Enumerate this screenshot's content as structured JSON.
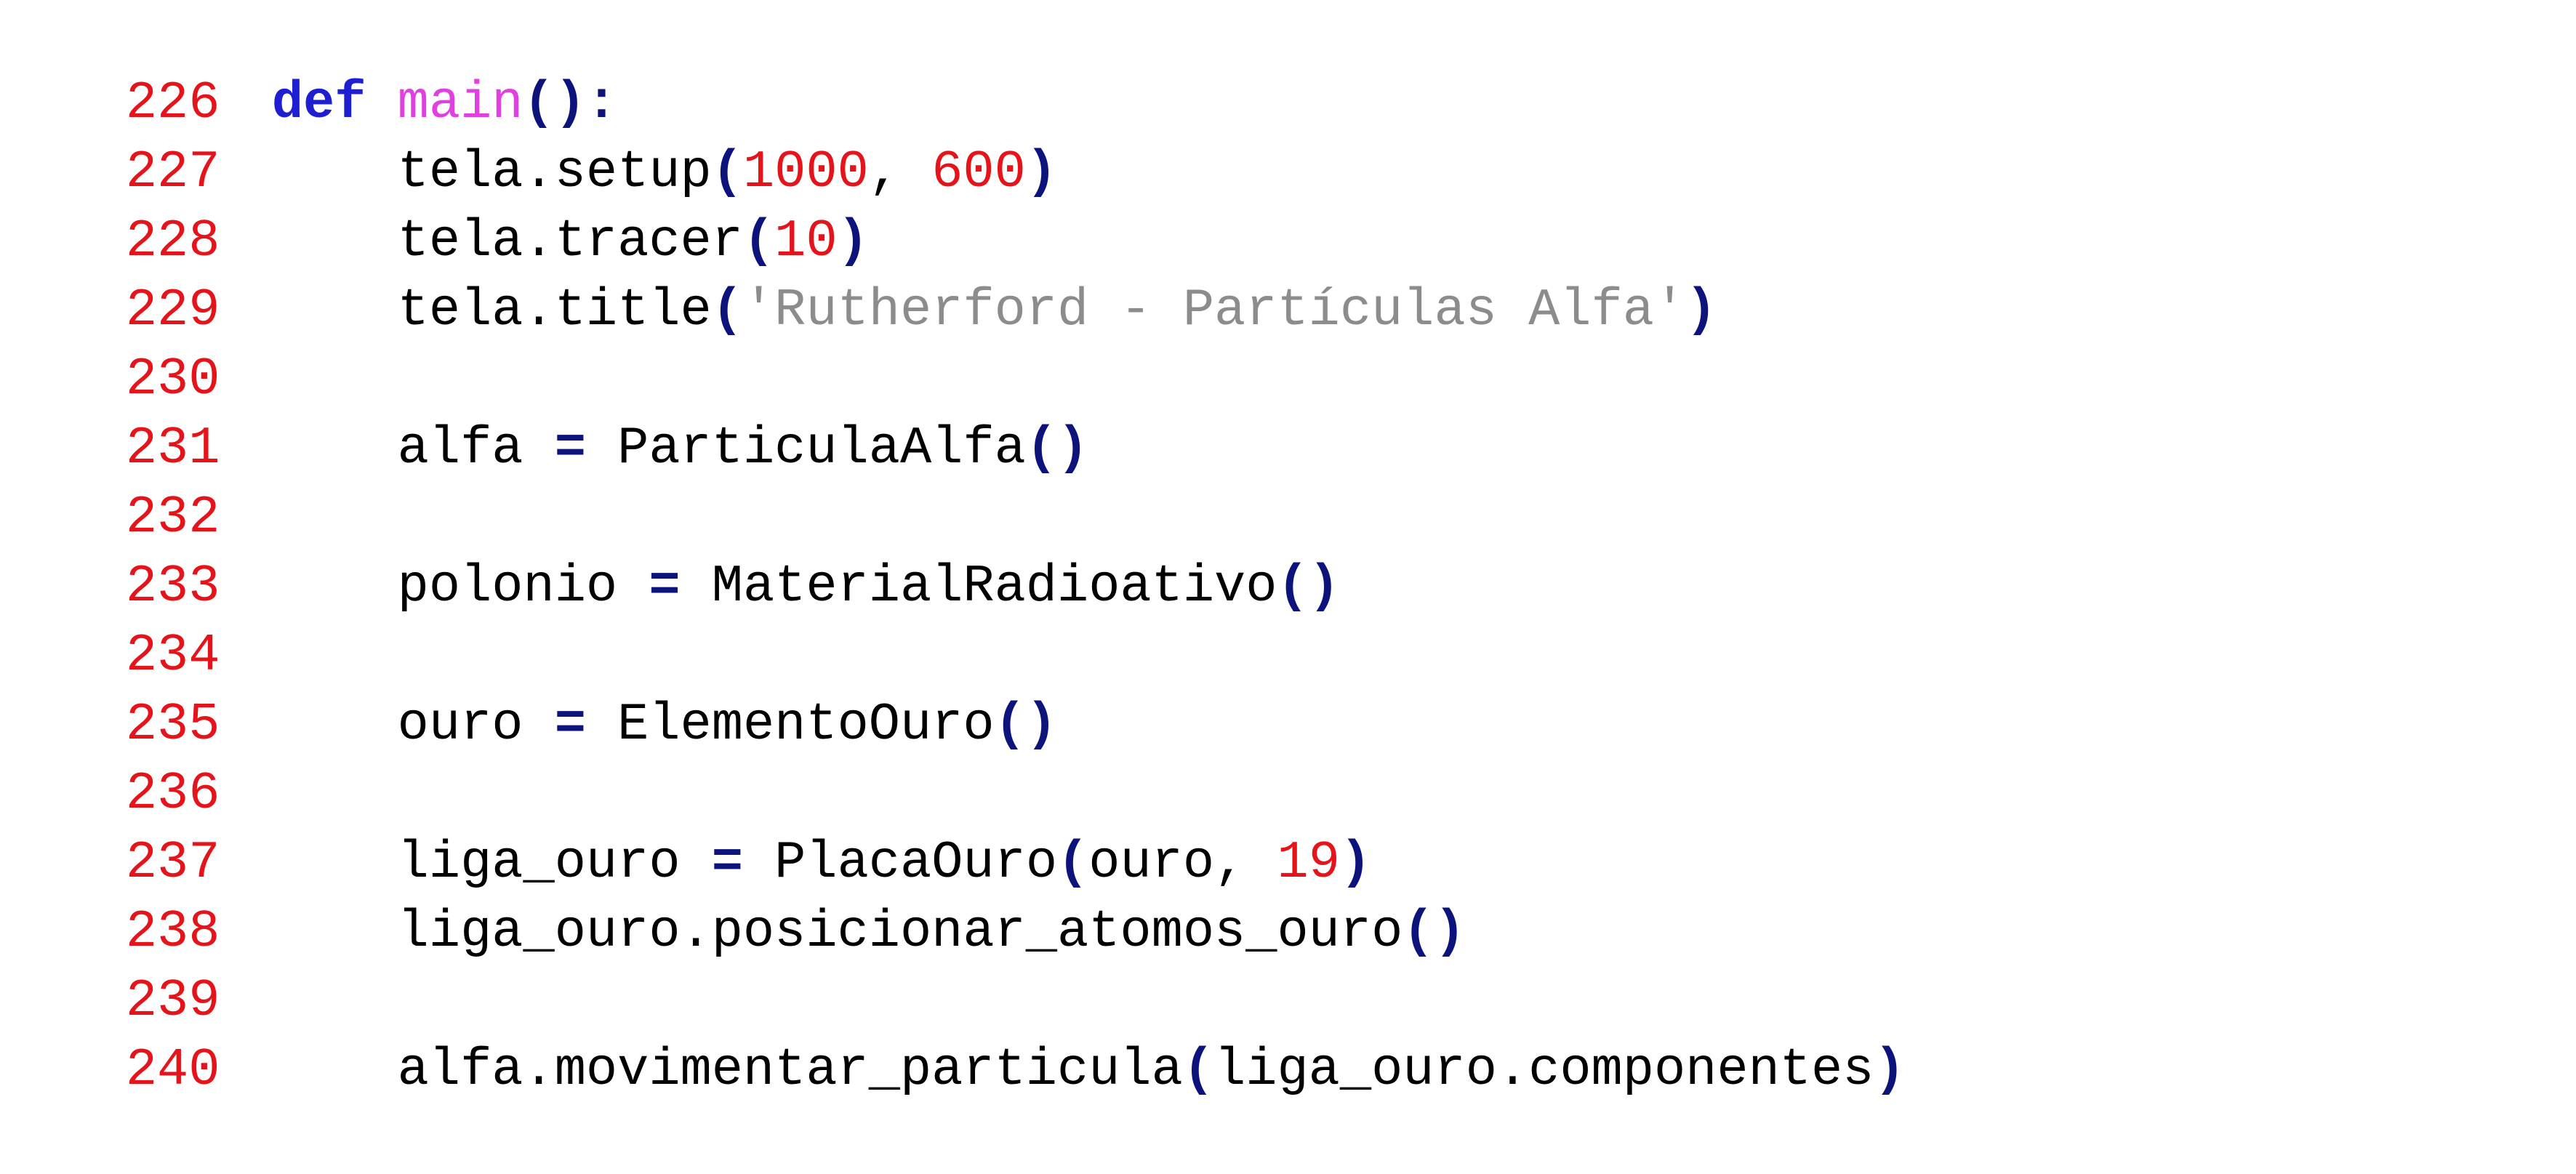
{
  "editor": {
    "lines": [
      {
        "number": "226",
        "tokens": [
          {
            "t": "def",
            "k": "kw"
          },
          {
            "t": " ",
            "k": "plain"
          },
          {
            "t": "main",
            "k": "fn"
          },
          {
            "t": "():",
            "k": "op"
          }
        ]
      },
      {
        "number": "227",
        "tokens": [
          {
            "t": "    tela.setup",
            "k": "plain"
          },
          {
            "t": "(",
            "k": "op"
          },
          {
            "t": "1000",
            "k": "num"
          },
          {
            "t": ", ",
            "k": "plain"
          },
          {
            "t": "600",
            "k": "num"
          },
          {
            "t": ")",
            "k": "op"
          }
        ]
      },
      {
        "number": "228",
        "tokens": [
          {
            "t": "    tela.tracer",
            "k": "plain"
          },
          {
            "t": "(",
            "k": "op"
          },
          {
            "t": "10",
            "k": "num"
          },
          {
            "t": ")",
            "k": "op"
          }
        ]
      },
      {
        "number": "229",
        "tokens": [
          {
            "t": "    tela.title",
            "k": "plain"
          },
          {
            "t": "(",
            "k": "op"
          },
          {
            "t": "'Rutherford - Partículas Alfa'",
            "k": "str"
          },
          {
            "t": ")",
            "k": "op"
          }
        ]
      },
      {
        "number": "230",
        "tokens": []
      },
      {
        "number": "231",
        "tokens": [
          {
            "t": "    alfa ",
            "k": "plain"
          },
          {
            "t": "=",
            "k": "op"
          },
          {
            "t": " ParticulaAlfa",
            "k": "plain"
          },
          {
            "t": "()",
            "k": "op"
          }
        ]
      },
      {
        "number": "232",
        "tokens": []
      },
      {
        "number": "233",
        "tokens": [
          {
            "t": "    polonio ",
            "k": "plain"
          },
          {
            "t": "=",
            "k": "op"
          },
          {
            "t": " MaterialRadioativo",
            "k": "plain"
          },
          {
            "t": "()",
            "k": "op"
          }
        ]
      },
      {
        "number": "234",
        "tokens": []
      },
      {
        "number": "235",
        "tokens": [
          {
            "t": "    ouro ",
            "k": "plain"
          },
          {
            "t": "=",
            "k": "op"
          },
          {
            "t": " ElementoOuro",
            "k": "plain"
          },
          {
            "t": "()",
            "k": "op"
          }
        ]
      },
      {
        "number": "236",
        "tokens": []
      },
      {
        "number": "237",
        "tokens": [
          {
            "t": "    liga_ouro ",
            "k": "plain"
          },
          {
            "t": "=",
            "k": "op"
          },
          {
            "t": " PlacaOuro",
            "k": "plain"
          },
          {
            "t": "(",
            "k": "op"
          },
          {
            "t": "ouro, ",
            "k": "plain"
          },
          {
            "t": "19",
            "k": "num"
          },
          {
            "t": ")",
            "k": "op"
          }
        ]
      },
      {
        "number": "238",
        "tokens": [
          {
            "t": "    liga_ouro.posicionar_atomos_ouro",
            "k": "plain"
          },
          {
            "t": "()",
            "k": "op"
          }
        ]
      },
      {
        "number": "239",
        "tokens": []
      },
      {
        "number": "240",
        "tokens": [
          {
            "t": "    alfa.movimentar_particula",
            "k": "plain"
          },
          {
            "t": "(",
            "k": "op"
          },
          {
            "t": "liga_ouro.componentes",
            "k": "plain"
          },
          {
            "t": ")",
            "k": "op"
          }
        ]
      }
    ]
  }
}
